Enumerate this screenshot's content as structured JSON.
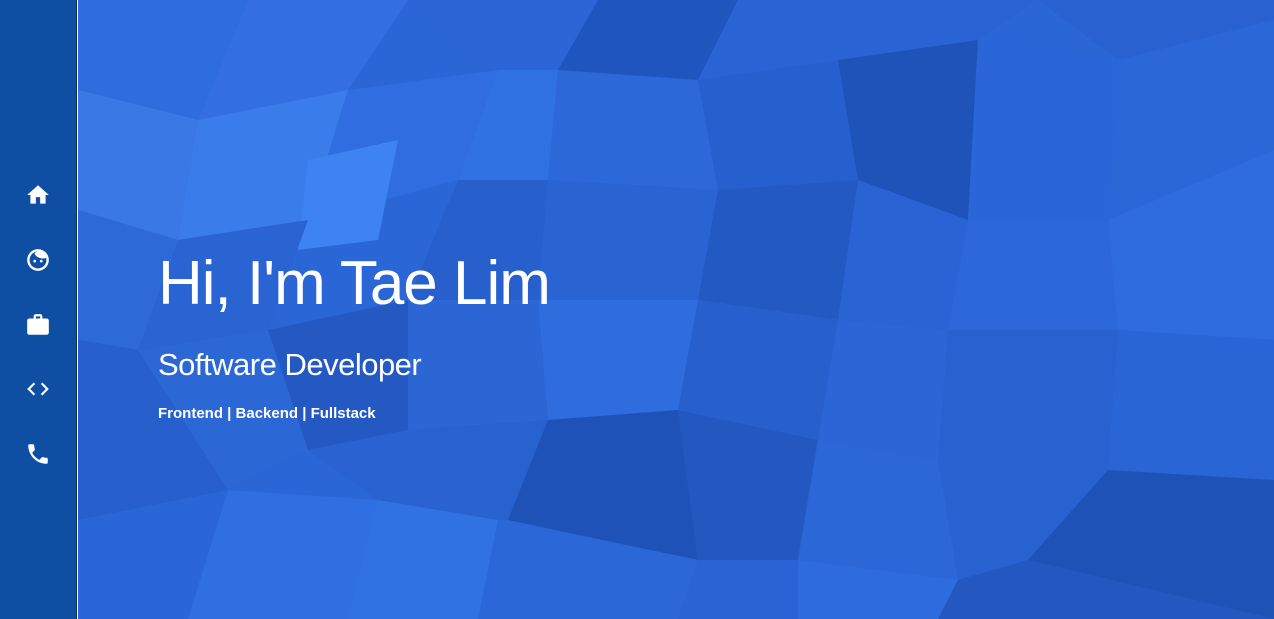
{
  "sidebar": {
    "items": [
      {
        "name": "home",
        "icon": "home-icon"
      },
      {
        "name": "about",
        "icon": "face-icon"
      },
      {
        "name": "work",
        "icon": "briefcase-icon"
      },
      {
        "name": "projects",
        "icon": "code-icon"
      },
      {
        "name": "contact",
        "icon": "phone-icon"
      }
    ]
  },
  "hero": {
    "headline": "Hi, I'm Tae Lim",
    "subtitle": "Software Developer",
    "tagline": "Frontend | Backend | Fullstack"
  },
  "colors": {
    "sidebar": "#0f4fa3",
    "hero_base": "#2a66d6",
    "text": "#ffffff"
  }
}
